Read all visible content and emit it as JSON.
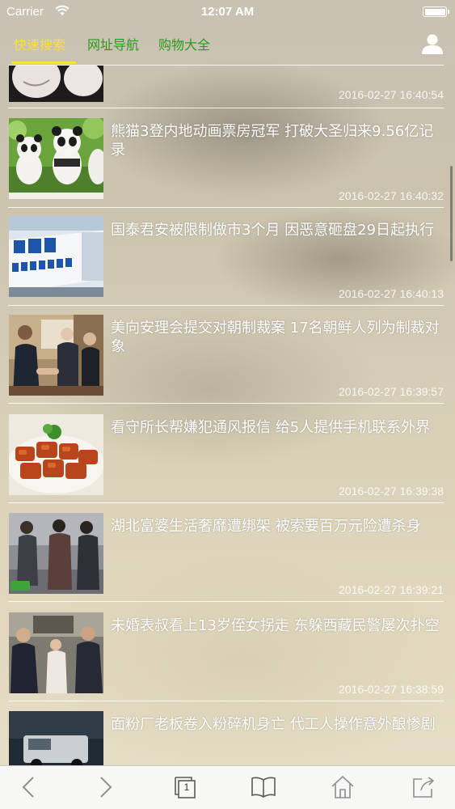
{
  "status_bar": {
    "carrier": "Carrier",
    "time": "12:07 AM"
  },
  "tabs": [
    {
      "label": "快速搜索",
      "active": true
    },
    {
      "label": "网址导航",
      "active": false
    },
    {
      "label": "购物大全",
      "active": false
    }
  ],
  "colors": {
    "active_tab": "#f6e52a",
    "inactive_tab": "#2c9a1c"
  },
  "news": [
    {
      "title": "",
      "time": "2016-02-27 16:40:54",
      "thumb": "couple-photo"
    },
    {
      "title": "熊猫3登内地动画票房冠军 打破大圣归来9.56亿记录",
      "time": "2016-02-27 16:40:32",
      "thumb": "kung-fu-panda"
    },
    {
      "title": "国泰君安被限制做市3个月 因恶意砸盘29日起执行",
      "time": "2016-02-27 16:40:13",
      "thumb": "guotai-sign"
    },
    {
      "title": "美向安理会提交对朝制裁案 17名朝鲜人列为制裁对象",
      "time": "2016-02-27 16:39:57",
      "thumb": "handshake"
    },
    {
      "title": "看守所长帮嫌犯通风报信 给5人提供手机联系外界",
      "time": "2016-02-27 16:39:38",
      "thumb": "braised-pork"
    },
    {
      "title": "湖北富婆生活奢靡遭绑架 被索要百万元险遭杀身",
      "time": "2016-02-27 16:39:21",
      "thumb": "arrest-scene"
    },
    {
      "title": "未婚表叔看上13岁侄女拐走 东躲西藏民警屡次扑空",
      "time": "2016-02-27 16:38:59",
      "thumb": "police-family"
    },
    {
      "title": "面粉厂老板卷入粉碎机身亡 代工人操作意外酿惨剧",
      "time": "",
      "thumb": "truck-night"
    }
  ],
  "toolbar": [
    {
      "icon": "back-icon"
    },
    {
      "icon": "forward-icon"
    },
    {
      "icon": "tabs-icon",
      "count": "1"
    },
    {
      "icon": "bookmarks-icon"
    },
    {
      "icon": "home-icon"
    },
    {
      "icon": "share-icon"
    }
  ]
}
